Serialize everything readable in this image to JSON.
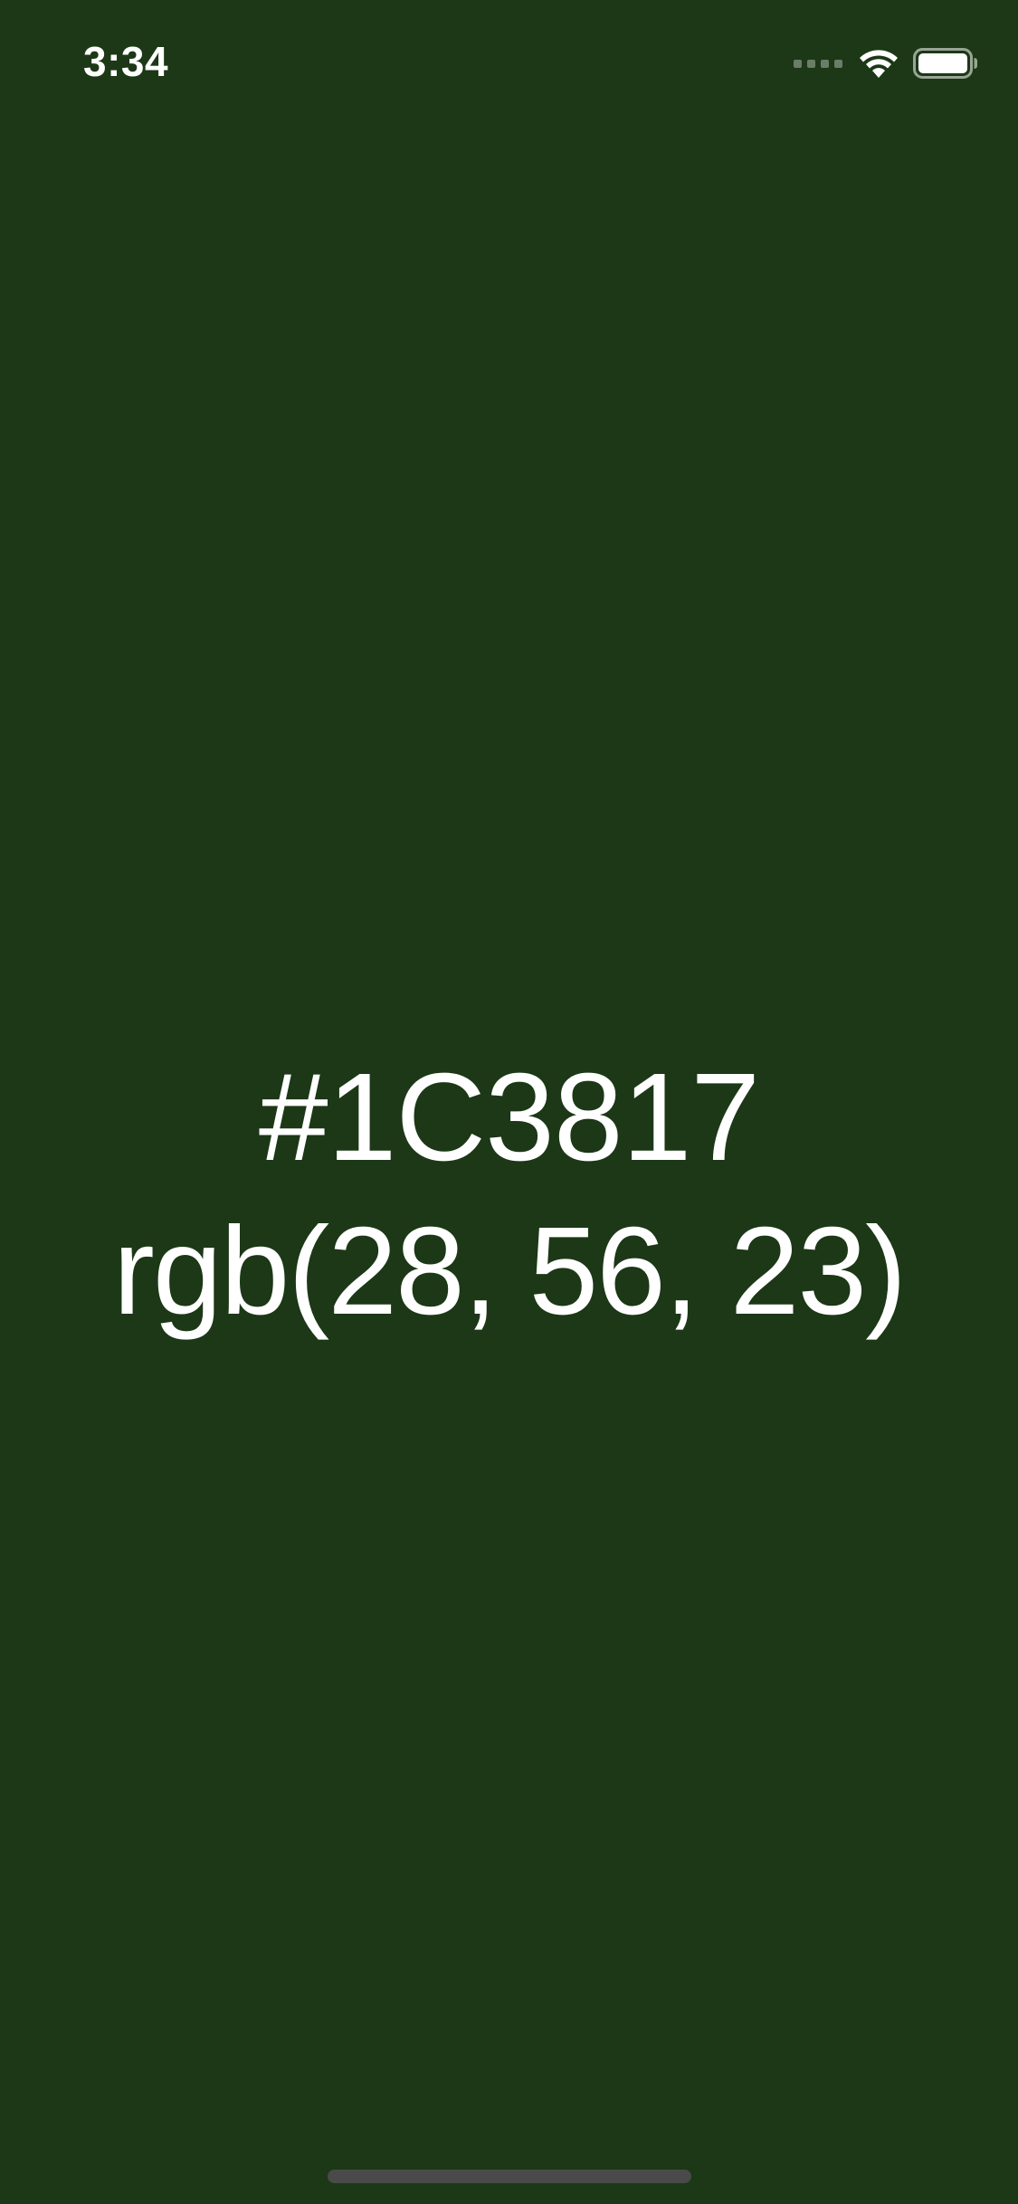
{
  "status_bar": {
    "time": "3:34",
    "signal": "signal-dots-icon",
    "wifi": "wifi-icon",
    "battery": "battery-icon"
  },
  "color": {
    "hex": "#1C3817",
    "rgb": "rgb(28, 56, 23)",
    "background": "#1C3817"
  }
}
